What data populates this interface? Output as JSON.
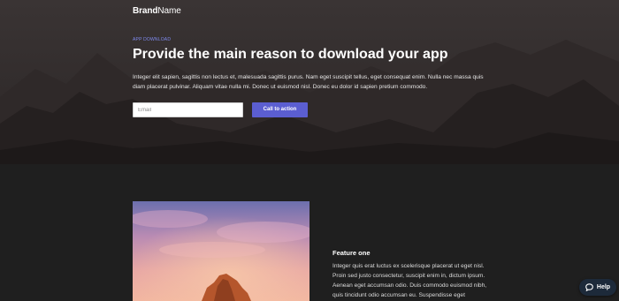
{
  "header": {
    "brand_bold": "Brand",
    "brand_rest": "Name"
  },
  "hero": {
    "eyebrow": "APP DOWNLOAD",
    "headline": "Provide the main reason to download your app",
    "lead": "Integer elit sapien, sagittis non lectus et, malesuada sagittis purus. Nam eget suscipit tellus, eget consequat enim. Nulla nec massa quis diam placerat pulvinar. Aliquam vitae nulla mi. Donec ut euismod nisl. Donec eu dolor id sapien pretium commodo.",
    "email_placeholder": "Email",
    "cta_label": "Call to action"
  },
  "features": {
    "items": [
      {
        "title": "Feature one",
        "body": "Integer quis erat luctus ex scelerisque placerat ut eget nisl. Proin sed justo consectetur, suscipit enim in, dictum ipsum. Aenean eget accumsan odio. Duis commodo euismod nibh, quis tincidunt odio accumsan eu. Suspendisse eget"
      }
    ]
  },
  "help_widget": {
    "label": "Help",
    "icon": "chat-bubble-icon"
  },
  "colors": {
    "accent": "#5b5ed1",
    "eyebrow": "#7f8bf0",
    "page_bg": "#1f1f1f",
    "help_bg": "#1d2a3a"
  }
}
